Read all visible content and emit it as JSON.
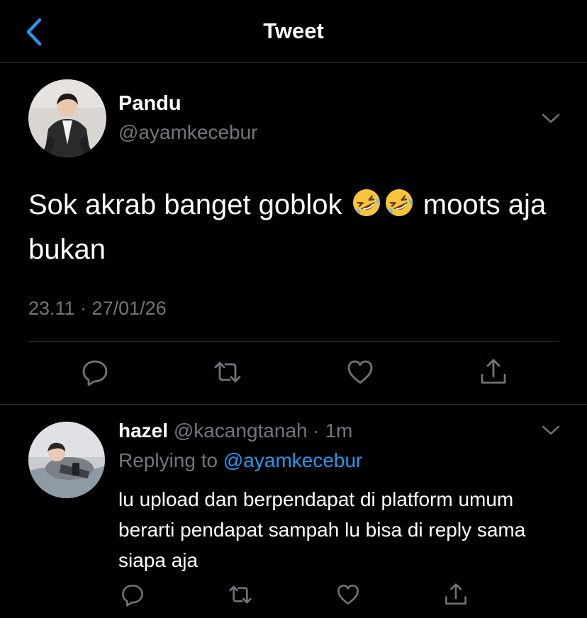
{
  "header": {
    "title": "Tweet"
  },
  "main_tweet": {
    "author_name": "Pandu",
    "author_handle": "@ayamkecebur",
    "text_part1": "Sok akrab banget goblok ",
    "emoji_1": "🤣",
    "emoji_2": "🤣",
    "text_part2": " moots aja bukan",
    "timestamp": "23.11 · 27/01/26"
  },
  "reply": {
    "author_name": "hazel",
    "author_handle": "@kacangtanah",
    "separator": " · ",
    "time_ago": "1m",
    "replying_to_label": "Replying to",
    "replying_to_handle": "@ayamkecebur",
    "text": "lu upload dan berpendapat di platform umum berarti pendapat sampah lu bisa di reply sama siapa aja"
  },
  "icons": [
    "back-chevron",
    "chevron-down",
    "reply",
    "retweet",
    "like",
    "share"
  ],
  "colors": {
    "background": "#000000",
    "text": "#e7e9ea",
    "muted": "#71767b",
    "accent": "#1d9bf0",
    "divider": "#2f3336"
  }
}
